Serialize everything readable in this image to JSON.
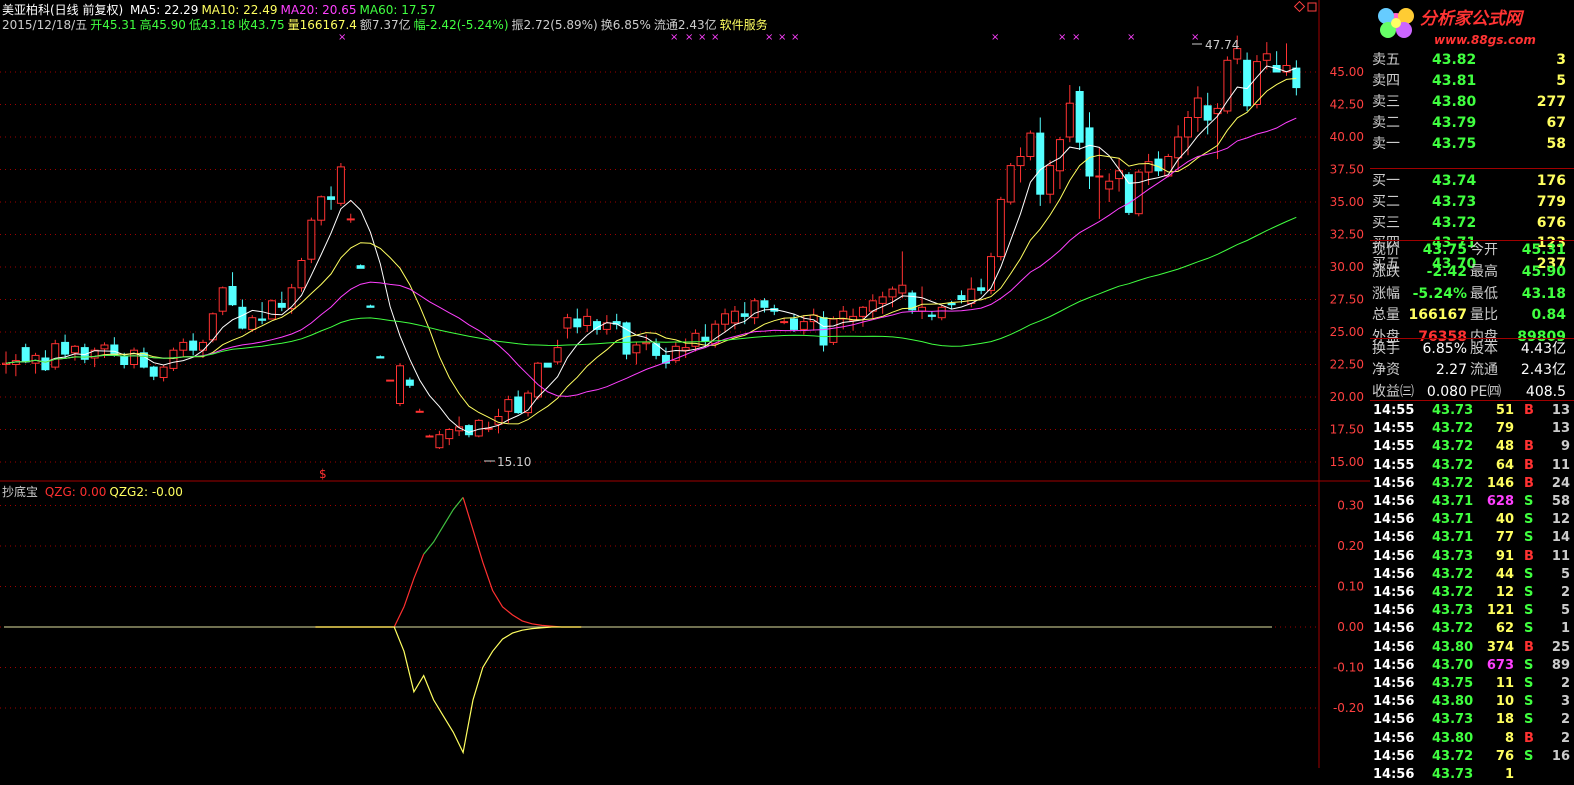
{
  "header": {
    "stock_name": "美亚柏科(日线 前复权)",
    "ma_items": [
      {
        "label": "MA5: 22.29",
        "color": "#ffffff"
      },
      {
        "label": "MA10: 22.49",
        "color": "#ffff60"
      },
      {
        "label": "MA20: 20.65",
        "color": "#ff40ff"
      },
      {
        "label": "MA60: 17.57",
        "color": "#40ff40"
      }
    ],
    "quote_items": [
      {
        "label": "2015/12/18/五",
        "color": "#cccccc"
      },
      {
        "label": "开45.31",
        "color": "#40ff40"
      },
      {
        "label": "高45.90",
        "color": "#40ff40"
      },
      {
        "label": "低43.18",
        "color": "#40ff40"
      },
      {
        "label": "收43.75",
        "color": "#40ff40"
      },
      {
        "label": "量166167.4",
        "color": "#ffff60"
      },
      {
        "label": "额7.37亿",
        "color": "#cccccc"
      },
      {
        "label": "幅-2.42(-5.24%)",
        "color": "#40ff40"
      },
      {
        "label": "振2.72(5.89%)",
        "color": "#cccccc"
      },
      {
        "label": "换6.85%",
        "color": "#cccccc"
      },
      {
        "label": "流通2.43亿",
        "color": "#cccccc"
      },
      {
        "label": "软件服务",
        "color": "#ffff60"
      }
    ]
  },
  "indicator": {
    "name": "抄底宝",
    "items": [
      {
        "label": "QZG: 0.00",
        "color": "#ff3030"
      },
      {
        "label": "QZG2: -0.00",
        "color": "#ffff60"
      }
    ],
    "axis_labels": [
      "0.30",
      "0.20",
      "0.10",
      "0.00",
      "-0.10",
      "-0.20"
    ]
  },
  "main_axis_labels": [
    "45.00",
    "42.50",
    "40.00",
    "37.50",
    "35.00",
    "32.50",
    "30.00",
    "27.50",
    "25.00",
    "22.50",
    "20.00",
    "17.50",
    "15.00"
  ],
  "annotations": {
    "high": "47.74",
    "low": "15.10",
    "signal": "$"
  },
  "colors": {
    "up": "#ff3232",
    "down": "#54ffff",
    "ma5": "#ffffff",
    "ma10": "#ffff60",
    "ma20": "#ff40ff",
    "ma60": "#40ff40",
    "grid": "#a00000",
    "bg": "#000000"
  },
  "order_book": {
    "asks": [
      {
        "label": "卖五",
        "price": "43.82",
        "vol": "3"
      },
      {
        "label": "卖四",
        "price": "43.81",
        "vol": "5"
      },
      {
        "label": "卖三",
        "price": "43.80",
        "vol": "277"
      },
      {
        "label": "卖二",
        "price": "43.79",
        "vol": "67"
      },
      {
        "label": "卖一",
        "price": "43.75",
        "vol": "58"
      }
    ],
    "bids": [
      {
        "label": "买一",
        "price": "43.74",
        "vol": "176"
      },
      {
        "label": "买二",
        "price": "43.73",
        "vol": "779"
      },
      {
        "label": "买三",
        "price": "43.72",
        "vol": "676"
      },
      {
        "label": "买四",
        "price": "43.71",
        "vol": "123"
      },
      {
        "label": "买五",
        "price": "43.70",
        "vol": "237"
      }
    ]
  },
  "quote_panel": [
    {
      "l1": "现价",
      "v1": "43.75",
      "c1": "#40ff40",
      "l2": "今开",
      "v2": "45.31",
      "c2": "#40ff40"
    },
    {
      "l1": "涨跌",
      "v1": "-2.42",
      "c1": "#40ff40",
      "l2": "最高",
      "v2": "45.90",
      "c2": "#40ff40"
    },
    {
      "l1": "涨幅",
      "v1": "-5.24%",
      "c1": "#40ff40",
      "l2": "最低",
      "v2": "43.18",
      "c2": "#40ff40"
    },
    {
      "l1": "总量",
      "v1": "166167",
      "c1": "#ffff60",
      "l2": "量比",
      "v2": "0.84",
      "c2": "#40ff40"
    },
    {
      "l1": "外盘",
      "v1": "76358",
      "c1": "#ff3232",
      "l2": "内盘",
      "v2": "89809",
      "c2": "#40ff40"
    }
  ],
  "stats_panel": [
    {
      "l1": "换手",
      "v1": "6.85%",
      "l2": "股本",
      "v2": "4.43亿"
    },
    {
      "l1": "净资",
      "v1": "2.27",
      "l2": "流通",
      "v2": "2.43亿"
    },
    {
      "l1": "收益㈢",
      "v1": "0.080",
      "l2": "PE㈣",
      "v2": "408.5"
    }
  ],
  "ticks": [
    {
      "time": "14:55",
      "price": "43.73",
      "vol": "51",
      "side": "B",
      "n": "13"
    },
    {
      "time": "14:55",
      "price": "43.72",
      "vol": "79",
      "side": "",
      "n": "13"
    },
    {
      "time": "14:55",
      "price": "43.72",
      "vol": "48",
      "side": "B",
      "n": "9"
    },
    {
      "time": "14:55",
      "price": "43.72",
      "vol": "64",
      "side": "B",
      "n": "11"
    },
    {
      "time": "14:56",
      "price": "43.72",
      "vol": "146",
      "side": "B",
      "n": "24"
    },
    {
      "time": "14:56",
      "price": "43.71",
      "vol": "628",
      "side": "S",
      "n": "58"
    },
    {
      "time": "14:56",
      "price": "43.71",
      "vol": "40",
      "side": "S",
      "n": "12"
    },
    {
      "time": "14:56",
      "price": "43.71",
      "vol": "77",
      "side": "S",
      "n": "14"
    },
    {
      "time": "14:56",
      "price": "43.73",
      "vol": "91",
      "side": "B",
      "n": "11"
    },
    {
      "time": "14:56",
      "price": "43.72",
      "vol": "44",
      "side": "S",
      "n": "5"
    },
    {
      "time": "14:56",
      "price": "43.72",
      "vol": "12",
      "side": "S",
      "n": "2"
    },
    {
      "time": "14:56",
      "price": "43.73",
      "vol": "121",
      "side": "S",
      "n": "5"
    },
    {
      "time": "14:56",
      "price": "43.72",
      "vol": "62",
      "side": "S",
      "n": "1"
    },
    {
      "time": "14:56",
      "price": "43.80",
      "vol": "374",
      "side": "B",
      "n": "25"
    },
    {
      "time": "14:56",
      "price": "43.70",
      "vol": "673",
      "side": "S",
      "n": "89"
    },
    {
      "time": "14:56",
      "price": "43.75",
      "vol": "11",
      "side": "S",
      "n": "2"
    },
    {
      "time": "14:56",
      "price": "43.80",
      "vol": "10",
      "side": "S",
      "n": "3"
    },
    {
      "time": "14:56",
      "price": "43.73",
      "vol": "18",
      "side": "S",
      "n": "2"
    },
    {
      "time": "14:56",
      "price": "43.80",
      "vol": "8",
      "side": "B",
      "n": "2"
    },
    {
      "time": "14:56",
      "price": "43.72",
      "vol": "76",
      "side": "S",
      "n": "16"
    },
    {
      "time": "14:56",
      "price": "43.73",
      "vol": "1",
      "side": "",
      "n": ""
    }
  ],
  "logo": {
    "title": "分析家公式网",
    "url": "www.88gs.com"
  },
  "chart_data": {
    "type": "candlestick",
    "price_ylim": [
      15.0,
      45.0
    ],
    "indicator_ylim": [
      -0.3,
      0.3
    ],
    "candles": [
      [
        22.5,
        23.5,
        21.8,
        22.6
      ],
      [
        22.5,
        23.3,
        21.6,
        22.8
      ],
      [
        23.8,
        24.1,
        22.6,
        22.7
      ],
      [
        22.6,
        23.4,
        21.8,
        23.2
      ],
      [
        23.0,
        23.6,
        22.0,
        22.1
      ],
      [
        22.3,
        24.4,
        22.1,
        24.1
      ],
      [
        24.2,
        24.8,
        23.0,
        23.3
      ],
      [
        23.4,
        24.0,
        22.8,
        23.9
      ],
      [
        23.8,
        24.1,
        22.6,
        22.9
      ],
      [
        23.0,
        23.8,
        22.3,
        23.6
      ],
      [
        23.7,
        24.2,
        23.0,
        24.0
      ],
      [
        24.0,
        24.6,
        23.1,
        23.2
      ],
      [
        23.1,
        23.4,
        22.2,
        22.5
      ],
      [
        22.5,
        23.8,
        22.2,
        23.6
      ],
      [
        23.4,
        23.8,
        22.2,
        22.3
      ],
      [
        22.3,
        22.4,
        21.3,
        21.6
      ],
      [
        21.5,
        22.5,
        21.2,
        22.3
      ],
      [
        22.2,
        23.8,
        22.0,
        23.6
      ],
      [
        23.6,
        24.5,
        23.1,
        24.2
      ],
      [
        24.3,
        24.9,
        23.2,
        23.6
      ],
      [
        23.6,
        24.4,
        23.0,
        24.2
      ],
      [
        24.4,
        26.5,
        24.2,
        26.4
      ],
      [
        26.6,
        28.5,
        26.3,
        28.4
      ],
      [
        28.5,
        29.6,
        27.0,
        27.1
      ],
      [
        26.9,
        27.5,
        25.2,
        25.3
      ],
      [
        25.2,
        26.3,
        25.0,
        26.1
      ],
      [
        26.0,
        27.3,
        25.6,
        25.9
      ],
      [
        26.0,
        27.5,
        26.0,
        27.4
      ],
      [
        27.2,
        28.1,
        26.6,
        26.9
      ],
      [
        26.8,
        28.7,
        26.4,
        28.4
      ],
      [
        28.4,
        30.7,
        28.1,
        30.5
      ],
      [
        30.6,
        33.8,
        30.3,
        33.6
      ],
      [
        33.6,
        35.5,
        33.2,
        35.4
      ],
      [
        35.4,
        36.2,
        34.4,
        35.2
      ],
      [
        34.9,
        38.0,
        34.7,
        37.7
      ],
      [
        33.7,
        34.1,
        33.4,
        33.7
      ],
      [
        30.1,
        30.2,
        29.9,
        29.9
      ],
      [
        27.0,
        27.1,
        26.9,
        26.9
      ],
      [
        23.1,
        23.2,
        23.0,
        23.0
      ],
      [
        21.3,
        21.3,
        21.3,
        21.3
      ],
      [
        19.5,
        22.6,
        19.3,
        22.4
      ],
      [
        21.3,
        21.5,
        20.7,
        20.9
      ],
      [
        18.9,
        19.1,
        18.8,
        18.9
      ],
      [
        17.0,
        17.1,
        16.9,
        17.0
      ],
      [
        16.1,
        17.4,
        16.0,
        17.1
      ],
      [
        16.8,
        17.6,
        16.3,
        17.5
      ],
      [
        17.4,
        18.5,
        17.0,
        17.7
      ],
      [
        17.8,
        17.9,
        16.9,
        17.1
      ],
      [
        17.0,
        18.3,
        16.9,
        18.2
      ],
      [
        17.6,
        18.1,
        17.3,
        17.6
      ],
      [
        17.9,
        19.1,
        17.2,
        18.5
      ],
      [
        18.9,
        20.1,
        18.0,
        19.8
      ],
      [
        20.0,
        20.5,
        18.7,
        18.8
      ],
      [
        18.8,
        20.5,
        18.5,
        20.3
      ],
      [
        20.0,
        22.7,
        19.8,
        22.6
      ],
      [
        22.6,
        22.6,
        22.3,
        22.3
      ],
      [
        22.7,
        24.4,
        22.5,
        23.8
      ],
      [
        25.3,
        26.4,
        24.5,
        26.1
      ],
      [
        26.0,
        26.8,
        24.9,
        25.4
      ],
      [
        25.5,
        26.8,
        25.0,
        26.2
      ],
      [
        25.8,
        26.0,
        24.8,
        25.2
      ],
      [
        25.2,
        26.3,
        24.8,
        25.7
      ],
      [
        25.8,
        26.4,
        25.2,
        25.6
      ],
      [
        25.7,
        25.8,
        22.9,
        23.3
      ],
      [
        23.4,
        24.2,
        22.5,
        24.0
      ],
      [
        24.1,
        24.8,
        23.6,
        24.2
      ],
      [
        24.1,
        24.5,
        22.9,
        23.2
      ],
      [
        23.2,
        23.8,
        22.2,
        22.6
      ],
      [
        22.8,
        24.2,
        22.6,
        23.9
      ],
      [
        23.6,
        24.5,
        23.0,
        23.8
      ],
      [
        23.9,
        25.2,
        23.5,
        24.9
      ],
      [
        24.6,
        25.6,
        23.9,
        24.3
      ],
      [
        24.1,
        25.9,
        23.8,
        25.6
      ],
      [
        25.6,
        26.8,
        25.0,
        26.4
      ],
      [
        25.7,
        27.0,
        25.2,
        26.6
      ],
      [
        26.4,
        27.3,
        25.6,
        26.2
      ],
      [
        26.1,
        27.6,
        25.6,
        27.4
      ],
      [
        27.4,
        27.6,
        26.5,
        26.9
      ],
      [
        26.8,
        27.1,
        26.3,
        26.6
      ],
      [
        25.8,
        26.1,
        25.6,
        25.8
      ],
      [
        26.0,
        26.4,
        25.0,
        25.2
      ],
      [
        25.2,
        26.3,
        24.8,
        25.8
      ],
      [
        25.8,
        26.8,
        25.1,
        26.3
      ],
      [
        26.1,
        26.6,
        23.5,
        24.0
      ],
      [
        24.2,
        26.2,
        24.0,
        26.0
      ],
      [
        26.0,
        27.0,
        25.2,
        26.6
      ],
      [
        25.9,
        26.8,
        25.1,
        26.2
      ],
      [
        26.2,
        27.0,
        25.4,
        26.9
      ],
      [
        26.6,
        27.9,
        26.0,
        27.4
      ],
      [
        27.2,
        28.1,
        26.4,
        27.7
      ],
      [
        27.7,
        28.5,
        26.9,
        28.3
      ],
      [
        28.0,
        31.2,
        27.6,
        28.6
      ],
      [
        28.0,
        28.2,
        26.4,
        26.7
      ],
      [
        26.6,
        28.5,
        26.0,
        26.9
      ],
      [
        26.3,
        26.6,
        25.9,
        26.2
      ],
      [
        26.1,
        27.1,
        25.9,
        26.9
      ],
      [
        27.2,
        27.4,
        26.8,
        27.1
      ],
      [
        27.8,
        28.2,
        27.2,
        27.5
      ],
      [
        27.2,
        29.2,
        26.9,
        28.3
      ],
      [
        28.4,
        29.1,
        27.9,
        28.2
      ],
      [
        28.2,
        31.1,
        27.9,
        30.8
      ],
      [
        30.8,
        35.4,
        30.5,
        35.2
      ],
      [
        35.0,
        38.0,
        34.8,
        37.8
      ],
      [
        37.8,
        39.2,
        36.5,
        38.5
      ],
      [
        38.5,
        40.5,
        38.2,
        40.3
      ],
      [
        40.3,
        41.5,
        34.7,
        35.6
      ],
      [
        35.6,
        38.2,
        34.9,
        37.8
      ],
      [
        37.4,
        40.0,
        36.0,
        39.8
      ],
      [
        40.0,
        44.0,
        39.6,
        42.6
      ],
      [
        43.5,
        43.9,
        39.0,
        39.6
      ],
      [
        40.7,
        41.9,
        36.0,
        37.0
      ],
      [
        37.0,
        39.2,
        33.7,
        37.0
      ],
      [
        36.0,
        37.2,
        35.0,
        36.6
      ],
      [
        36.8,
        38.4,
        35.8,
        37.4
      ],
      [
        37.1,
        37.3,
        34.0,
        34.2
      ],
      [
        34.1,
        37.5,
        33.9,
        37.3
      ],
      [
        37.3,
        38.7,
        36.3,
        38.1
      ],
      [
        38.3,
        38.9,
        37.0,
        37.4
      ],
      [
        37.0,
        38.7,
        36.9,
        38.5
      ],
      [
        38.4,
        40.9,
        37.4,
        40.0
      ],
      [
        40.0,
        42.0,
        38.6,
        41.5
      ],
      [
        41.5,
        43.9,
        40.4,
        43.0
      ],
      [
        42.4,
        43.4,
        40.2,
        41.3
      ],
      [
        41.8,
        42.6,
        38.3,
        42.2
      ],
      [
        42.0,
        46.2,
        41.8,
        45.9
      ],
      [
        46.0,
        47.8,
        45.6,
        46.8
      ],
      [
        45.9,
        46.5,
        42.0,
        42.4
      ],
      [
        42.5,
        46.3,
        42.2,
        45.8
      ],
      [
        45.9,
        47.3,
        45.2,
        46.4
      ],
      [
        45.5,
        46.6,
        45.0,
        45.0
      ],
      [
        45.0,
        47.2,
        44.7,
        45.5
      ],
      [
        45.3,
        45.9,
        43.2,
        43.8
      ]
    ],
    "qzg": [
      0,
      0,
      0,
      0,
      0,
      0,
      0,
      0,
      0,
      0.05,
      0.12,
      0.18,
      0.21,
      0.25,
      0.29,
      0.32,
      0.24,
      0.16,
      0.09,
      0.05,
      0.03,
      0.015,
      0.008,
      0.004,
      0.002,
      0,
      0,
      0
    ],
    "qzg2": [
      0,
      0,
      0,
      0,
      0,
      0,
      0,
      0,
      0,
      -0.06,
      -0.16,
      -0.12,
      -0.18,
      -0.22,
      -0.26,
      -0.31,
      -0.18,
      -0.1,
      -0.06,
      -0.03,
      -0.015,
      -0.008,
      -0.004,
      -0.002,
      0,
      0,
      0,
      0
    ]
  }
}
